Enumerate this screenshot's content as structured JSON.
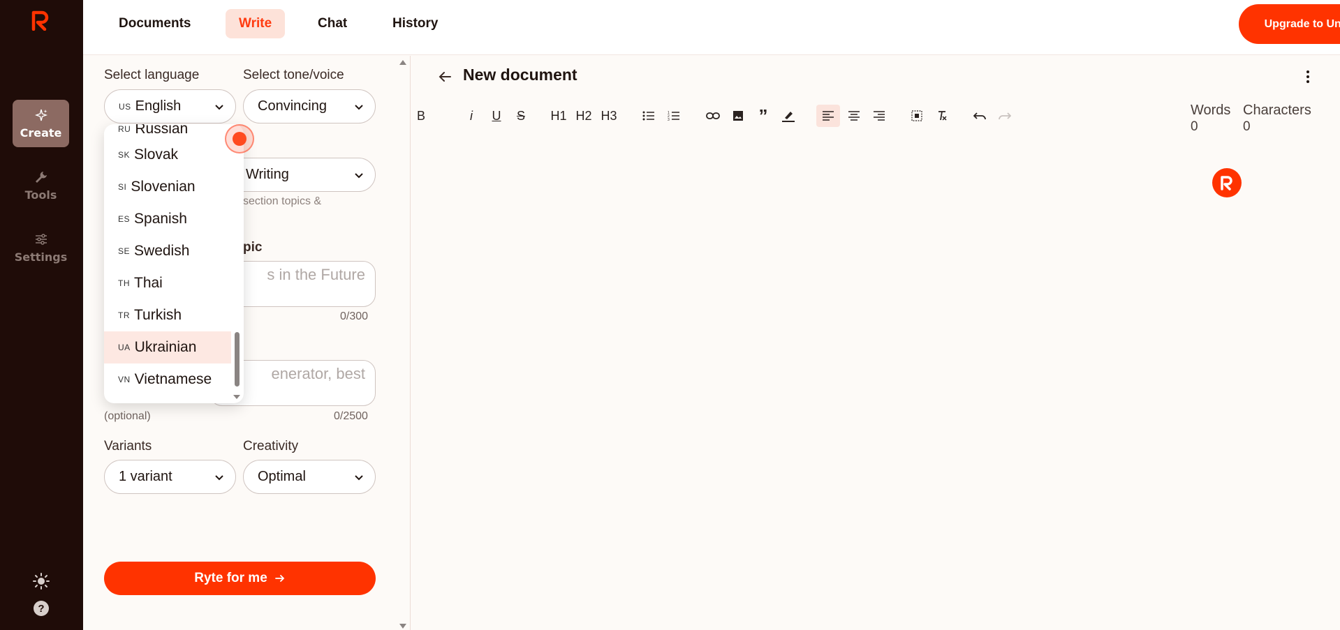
{
  "topbar": {
    "tabs": [
      {
        "label": "Documents"
      },
      {
        "label": "Write"
      },
      {
        "label": "Chat"
      },
      {
        "label": "History"
      }
    ],
    "upgrade_label": "Upgrade to Unlimited"
  },
  "rail": {
    "items": [
      {
        "label": "Create",
        "icon": "sparkle-icon"
      },
      {
        "label": "Tools",
        "icon": "wrench-icon"
      },
      {
        "label": "Settings",
        "icon": "sliders-icon"
      }
    ],
    "bottom_icons": [
      "sun-icon",
      "help-icon"
    ]
  },
  "form": {
    "language_label": "Select language",
    "language_value_code": "US",
    "language_value": "English",
    "tone_label": "Select tone/voice",
    "tone_value": "Convincing",
    "usecase_value": "Writing",
    "usecase_hint": "section topics &",
    "topic_label_partial": "pic",
    "topic_placeholder_partial": "s in the Future",
    "topic_counter": "0/300",
    "keywords_placeholder_partial": "enerator, best",
    "keywords_optional": "(optional)",
    "keywords_counter": "0/2500",
    "variants_label": "Variants",
    "variants_value": "1 variant",
    "creativity_label": "Creativity",
    "creativity_value": "Optimal",
    "submit_label": "Ryte for me"
  },
  "language_dropdown": {
    "items": [
      {
        "code": "RU",
        "name": "Russian"
      },
      {
        "code": "SK",
        "name": "Slovak"
      },
      {
        "code": "SI",
        "name": "Slovenian"
      },
      {
        "code": "ES",
        "name": "Spanish"
      },
      {
        "code": "SE",
        "name": "Swedish"
      },
      {
        "code": "TH",
        "name": "Thai"
      },
      {
        "code": "TR",
        "name": "Turkish"
      },
      {
        "code": "UA",
        "name": "Ukrainian"
      },
      {
        "code": "VN",
        "name": "Vietnamese"
      }
    ],
    "highlighted": "Ukrainian"
  },
  "editor": {
    "title": "New document",
    "toolbar": {
      "bold": "B",
      "italic": "i",
      "underline": "U",
      "strike": "S",
      "h1": "H1",
      "h2": "H2",
      "h3": "H3"
    },
    "words_label": "Words",
    "words_value": "0",
    "chars_label": "Characters",
    "chars_value": "0"
  },
  "colors": {
    "accent": "#ff3300",
    "rail_bg": "#1f0c08",
    "active_tab_bg": "#fde2d9"
  }
}
